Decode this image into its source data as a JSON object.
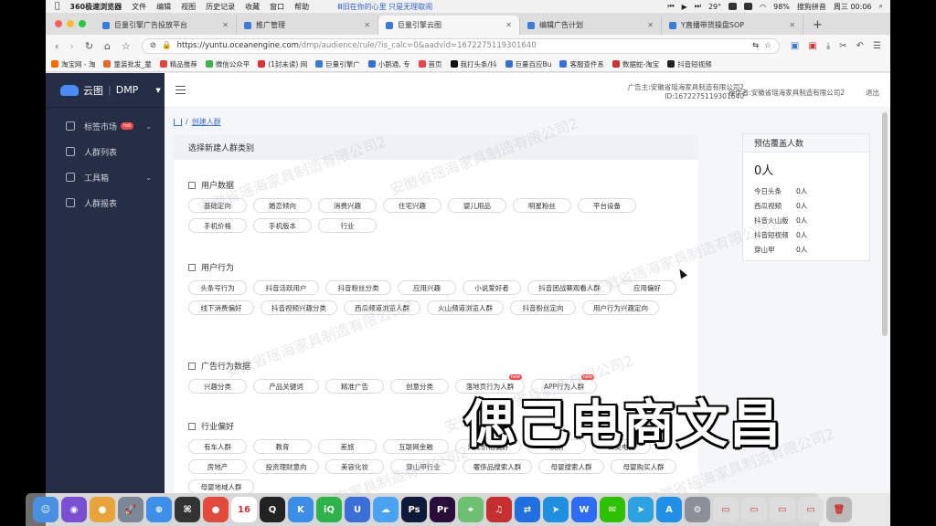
{
  "menubar": {
    "app_name": "360极速浏览器",
    "items": [
      "文件",
      "编辑",
      "视图",
      "历史记录",
      "收藏",
      "窗口",
      "帮助"
    ],
    "now_playing": "Ⅲ旧在你的心里 只是无理取闹",
    "battery": "98%",
    "temp": "29°",
    "search_label": "搜狗拼音",
    "clock": "周三 00:06"
  },
  "tabs": [
    {
      "title": "巨量引擎广告投放平台",
      "active": false
    },
    {
      "title": "推广管理",
      "active": false
    },
    {
      "title": "巨量引擎云图",
      "active": true
    },
    {
      "title": "编辑广告计划",
      "active": false
    },
    {
      "title": "Y直播带货操盘SOP",
      "active": false
    }
  ],
  "newtab_label": "+",
  "address": {
    "url_main": "https://yuntu.oceanengine.com",
    "url_rest": "/dmp/audience/rule/?is_calc=0&aadvid=1672275119301640"
  },
  "bookmarks": [
    {
      "label": "淘宝网 - 淘",
      "color": "#ff6a00"
    },
    {
      "label": "童装批发_童",
      "color": "#e8672a"
    },
    {
      "label": "精品推荐",
      "color": "#e0463b"
    },
    {
      "label": "微信公众平",
      "color": "#3bb54a"
    },
    {
      "label": "(1封未读) 网",
      "color": "#d33"
    },
    {
      "label": "巨量引擎广",
      "color": "#3a7bd5"
    },
    {
      "label": "小鹅通, 专",
      "color": "#2f6fd6"
    },
    {
      "label": "首页",
      "color": "#e44"
    },
    {
      "label": "我打头条/抖",
      "color": "#111"
    },
    {
      "label": "巨量百应Bu",
      "color": "#3a6fd8"
    },
    {
      "label": "客服查件系",
      "color": "#3a6fd8"
    },
    {
      "label": "数据蛇-淘宝",
      "color": "#c33"
    },
    {
      "label": "抖音短视频",
      "color": "#222"
    }
  ],
  "app": {
    "brand": "云图",
    "product": "DMP",
    "advertiser_line1": "广告主:安徽省瑶海家具制造有限公司2",
    "advertiser_line2": "ID:1672275119301640",
    "operator": "操作者:安徽省瑶海家具制造有限公司2",
    "logout": "退出"
  },
  "sidebar": {
    "items": [
      {
        "label": "标签市场",
        "hot": "hot",
        "arrow": "⌄"
      },
      {
        "label": "人群列表",
        "hot": "",
        "arrow": ""
      },
      {
        "label": "工具箱",
        "hot": "",
        "arrow": "⌄"
      },
      {
        "label": "人群报表",
        "hot": "",
        "arrow": ""
      }
    ]
  },
  "breadcrumb": {
    "current": "创建人群",
    "sep": "/"
  },
  "panel": {
    "heading": "选择新建人群类别",
    "groups": [
      {
        "title": "用户数据",
        "chips": [
          {
            "label": "基础定向",
            "w": 64
          },
          {
            "label": "婚恋倾向",
            "w": 64
          },
          {
            "label": "消费兴趣",
            "w": 64
          },
          {
            "label": "住宅兴趣",
            "w": 64
          },
          {
            "label": "婴儿用品",
            "w": 64
          },
          {
            "label": "明星粉丝",
            "w": 64
          },
          {
            "label": "平台设备",
            "w": 64
          },
          {
            "label": "手机价格",
            "w": 64
          },
          {
            "label": "手机版本",
            "w": 64
          },
          {
            "label": "行业",
            "w": 64
          }
        ]
      },
      {
        "title": "用户行为",
        "chips": [
          {
            "label": "头条号行为",
            "w": 64
          },
          {
            "label": "抖音活跃用户",
            "w": 72
          },
          {
            "label": "抖音粉丝分类",
            "w": 72
          },
          {
            "label": "应用兴趣",
            "w": 64
          },
          {
            "label": "小说爱好者",
            "w": 64
          },
          {
            "label": "抖音团战赛观看人群",
            "w": 92
          },
          {
            "label": "应用偏好",
            "w": 64
          },
          {
            "label": "线下消费偏好",
            "w": 72
          },
          {
            "label": "抖音视频兴趣分类",
            "w": 84
          },
          {
            "label": "西瓜频道浏览人群",
            "w": 84
          },
          {
            "label": "火山频道浏览人群",
            "w": 84
          },
          {
            "label": "抖音粉丝定向",
            "w": 72
          },
          {
            "label": "用户行为兴趣定向",
            "w": 84
          }
        ]
      },
      {
        "title": "广告行为数据",
        "chips": [
          {
            "label": "兴趣分类",
            "w": 64,
            "tag": ""
          },
          {
            "label": "产品关键词",
            "w": 72,
            "tag": ""
          },
          {
            "label": "精准广告",
            "w": 64,
            "tag": ""
          },
          {
            "label": "创意分类",
            "w": 64,
            "tag": ""
          },
          {
            "label": "落地页行为人群",
            "w": 76,
            "tag": "new"
          },
          {
            "label": "APP行为人群",
            "w": 72,
            "tag": "new"
          }
        ]
      },
      {
        "title": "行业偏好",
        "chips": [
          {
            "label": "有车人群",
            "w": 64
          },
          {
            "label": "教育",
            "w": 64
          },
          {
            "label": "差旅",
            "w": 64
          },
          {
            "label": "互联网金融",
            "w": 72
          },
          {
            "label": "汽车价格偏好",
            "w": 72
          },
          {
            "label": "快消",
            "w": 64
          },
          {
            "label": "二类电商",
            "w": 64
          },
          {
            "label": "房地产",
            "w": 64
          },
          {
            "label": "投资理财意向",
            "w": 72
          },
          {
            "label": "美容化妆",
            "w": 64
          },
          {
            "label": "穿山甲行业",
            "w": 72
          },
          {
            "label": "奢侈品搜索人群",
            "w": 76
          },
          {
            "label": "母婴搜索人群",
            "w": 72
          },
          {
            "label": "母婴购买人群",
            "w": 72
          },
          {
            "label": "母婴地域人群",
            "w": 72
          }
        ]
      }
    ]
  },
  "coverage": {
    "title": "预估覆盖人数",
    "total": "0人",
    "rows": [
      {
        "name": "今日头条",
        "value": "0人"
      },
      {
        "name": "西瓜视频",
        "value": "0人"
      },
      {
        "name": "抖音火山版",
        "value": "0人"
      },
      {
        "name": "抖音短视频",
        "value": "0人"
      },
      {
        "name": "穿山甲",
        "value": "0人"
      }
    ]
  },
  "overlay_caption": "偲己电商文昌",
  "watermark_text": "安徽省瑶海家具制造有限公司2",
  "dock": [
    {
      "name": "finder",
      "color": "#4a90e2",
      "g": "☺"
    },
    {
      "name": "siri",
      "color": "#7a4fd1",
      "g": "◉"
    },
    {
      "name": "chrome",
      "color": "#e8a33b",
      "g": "●"
    },
    {
      "name": "launchpad",
      "color": "#7b8794",
      "g": "🚀"
    },
    {
      "name": "safari",
      "color": "#3d8fe8",
      "g": "⊕"
    },
    {
      "name": "network",
      "color": "#333",
      "g": "⌘"
    },
    {
      "name": "chrome2",
      "color": "#e24b3b",
      "g": "●"
    },
    {
      "name": "calendar",
      "color": "#fff",
      "g": "16"
    },
    {
      "name": "qq",
      "color": "#222",
      "g": "Q"
    },
    {
      "name": "kuwo",
      "color": "#3a8ee8",
      "g": "K"
    },
    {
      "name": "iqiyi",
      "color": "#2db34a",
      "g": "iQ"
    },
    {
      "name": "ucbrowser",
      "color": "#3a6fd8",
      "g": "U"
    },
    {
      "name": "baidu-netdisk",
      "color": "#4aa3f0",
      "g": "☁"
    },
    {
      "name": "photoshop",
      "color": "#0f1a3a",
      "g": "Ps"
    },
    {
      "name": "premiere",
      "color": "#2a0e3a",
      "g": "Pr"
    },
    {
      "name": "maps",
      "color": "#6cc070",
      "g": "⌖"
    },
    {
      "name": "netease-music",
      "color": "#c62f2f",
      "g": "♫"
    },
    {
      "name": "teamviewer",
      "color": "#1f6fe0",
      "g": "⇄"
    },
    {
      "name": "feishu",
      "color": "#1f8fe0",
      "g": "➤"
    },
    {
      "name": "wps",
      "color": "#2b6ef5",
      "g": "W"
    },
    {
      "name": "wechat",
      "color": "#2dc100",
      "g": "✉"
    },
    {
      "name": "telegram",
      "color": "#2aa3e0",
      "g": "➤"
    },
    {
      "name": "appstore",
      "color": "#1f8fe8",
      "g": "A"
    },
    {
      "name": "settings",
      "color": "#8a8f98",
      "g": "⚙"
    },
    {
      "name": "preview",
      "color": "#ddd",
      "g": "▭"
    },
    {
      "name": "screenshot",
      "color": "#ddd",
      "g": "▭"
    },
    {
      "name": "notes",
      "color": "#ddd",
      "g": "▭"
    },
    {
      "name": "downloads",
      "color": "#ddd",
      "g": "▭"
    },
    {
      "name": "trash",
      "color": "#bbb",
      "g": "🗑"
    }
  ]
}
